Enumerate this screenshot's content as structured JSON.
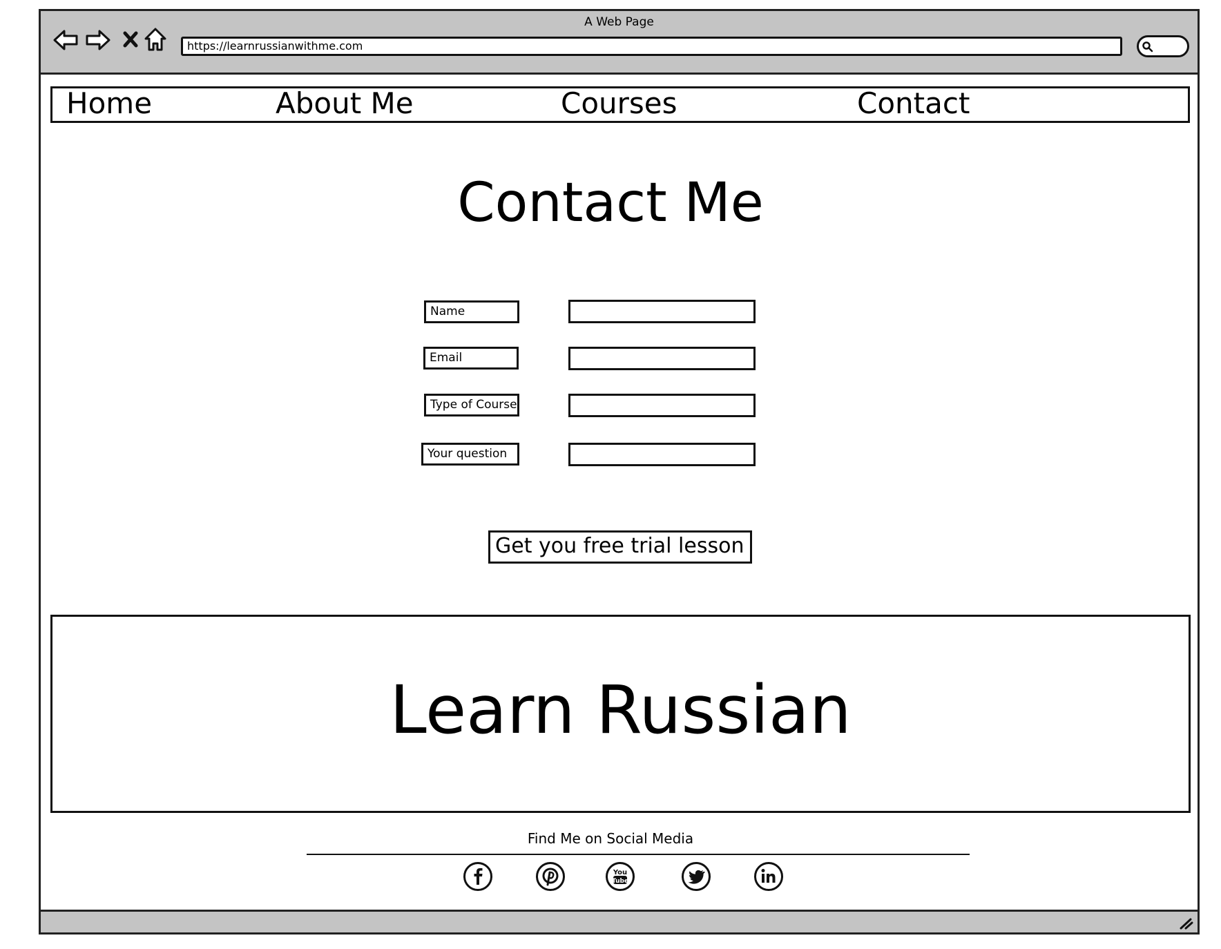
{
  "window": {
    "title": "A Web Page",
    "url": "https://learnrussianwithme.com"
  },
  "toolbar": {
    "back_icon": "back-arrow-icon",
    "forward_icon": "forward-arrow-icon",
    "stop_icon": "close-icon",
    "home_icon": "home-icon",
    "search_icon": "search-icon"
  },
  "nav": {
    "items": [
      "Home",
      "About Me",
      "Courses",
      "Contact"
    ]
  },
  "main": {
    "title": "Contact Me",
    "form": {
      "fields": [
        {
          "label": "Name",
          "value": ""
        },
        {
          "label": "Email",
          "value": ""
        },
        {
          "label": "Type of Course",
          "value": ""
        },
        {
          "label": "Your question",
          "value": ""
        }
      ],
      "submit_label": "Get you free trial lesson"
    }
  },
  "banner": {
    "text": "Learn Russian"
  },
  "footer": {
    "social_title": "Find Me on Social Media",
    "social_icons": [
      "facebook-icon",
      "pinterest-icon",
      "youtube-icon",
      "twitter-icon",
      "linkedin-icon"
    ]
  },
  "colors": {
    "chrome": "#c4c4c4",
    "ink": "#111111",
    "background": "#ffffff"
  }
}
